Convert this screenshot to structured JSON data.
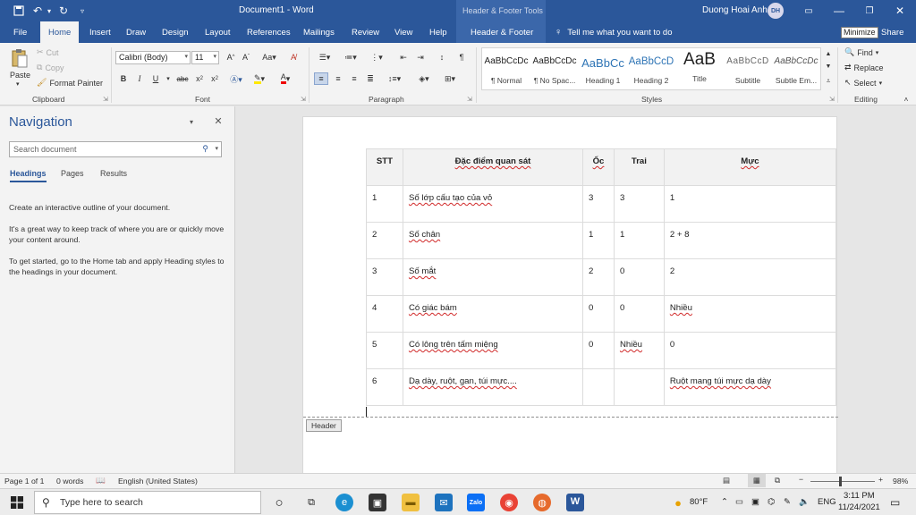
{
  "titlebar": {
    "doc_title": "Document1  -  Word",
    "contextual_group": "Header & Footer Tools",
    "user_name": "Duong Hoai Anh",
    "user_initials": "DH"
  },
  "tabs": [
    "File",
    "Home",
    "Insert",
    "Draw",
    "Design",
    "Layout",
    "References",
    "Mailings",
    "Review",
    "View",
    "Help"
  ],
  "contextual_tab": "Header & Footer",
  "tell_me": "Tell me what you want to do",
  "minimize_tooltip": "Minimize",
  "share": "Share",
  "clipboard": {
    "paste": "Paste",
    "cut": "Cut",
    "copy": "Copy",
    "format_painter": "Format Painter",
    "label": "Clipboard"
  },
  "font": {
    "family": "Calibri (Body)",
    "size": "11",
    "label": "Font"
  },
  "paragraph": {
    "label": "Paragraph"
  },
  "styles": {
    "label": "Styles",
    "items": [
      {
        "sample": "AaBbCcDc",
        "name": "¶ Normal"
      },
      {
        "sample": "AaBbCcDc",
        "name": "¶ No Spac..."
      },
      {
        "sample": "AaBbCc",
        "name": "Heading 1"
      },
      {
        "sample": "AaBbCcD",
        "name": "Heading 2"
      },
      {
        "sample": "AaB",
        "name": "Title"
      },
      {
        "sample": "AaBbCcD",
        "name": "Subtitle"
      },
      {
        "sample": "AaBbCcDc",
        "name": "Subtle Em..."
      }
    ]
  },
  "editing": {
    "find": "Find",
    "replace": "Replace",
    "select": "Select",
    "label": "Editing"
  },
  "navigation": {
    "title": "Navigation",
    "search_placeholder": "Search document",
    "tabs": [
      "Headings",
      "Pages",
      "Results"
    ],
    "para1": "Create an interactive outline of your document.",
    "para2": "It's a great way to keep track of where you are or quickly move your content around.",
    "para3": "To get started, go to the Home tab and apply Heading styles to the headings in your document."
  },
  "table": {
    "headers": [
      "STT",
      "Đặc điểm quan sát",
      "Ốc",
      "Trai",
      "Mực"
    ],
    "rows": [
      [
        "1",
        "Số lớp cấu tạo của vỏ",
        "3",
        "3",
        "1"
      ],
      [
        "2",
        "Số chân",
        "1",
        "1",
        "2 + 8"
      ],
      [
        "3",
        "Số mắt",
        "2",
        "0",
        "2"
      ],
      [
        "4",
        "Có giác bám",
        "0",
        "0",
        "Nhiều"
      ],
      [
        "5",
        "Có lông trên tấm miệng",
        "0",
        "Nhiều",
        "0"
      ],
      [
        "6",
        "Dạ dày, ruột, gan, túi mực....",
        "",
        "",
        "Ruột mang túi mực dạ dày"
      ]
    ]
  },
  "header_tag": "Header",
  "statusbar": {
    "page": "Page 1 of 1",
    "words": "0 words",
    "language": "English (United States)",
    "zoom": "98%",
    "zoom_minus": "−",
    "zoom_plus": "+"
  },
  "taskbar": {
    "search_placeholder": "Type here to search",
    "weather": "80°F",
    "lang": "ENG",
    "time": "3:11 PM",
    "date": "11/24/2021"
  }
}
